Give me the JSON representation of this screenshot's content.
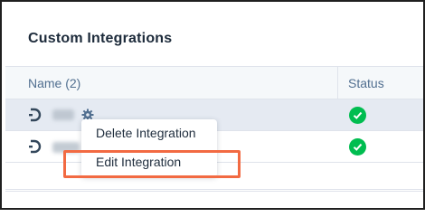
{
  "card": {
    "title": "Custom Integrations"
  },
  "table": {
    "headers": {
      "name": "Name (2)",
      "status": "Status"
    },
    "rows": [
      {
        "name": "",
        "status": "connected",
        "selected": true
      },
      {
        "name": "",
        "status": "connected",
        "selected": false
      }
    ]
  },
  "context_menu": {
    "items": [
      {
        "label": "Delete Integration"
      },
      {
        "label": "Edit Integration"
      }
    ]
  },
  "colors": {
    "status_ok": "#00bd50",
    "highlight": "#f26a42",
    "selected_row": "#e5eaf2",
    "header_bg": "#f5f8fa"
  },
  "icons": {
    "app_logo": "d-logo-icon",
    "settings": "gear-icon",
    "status": "check-circle-icon"
  }
}
